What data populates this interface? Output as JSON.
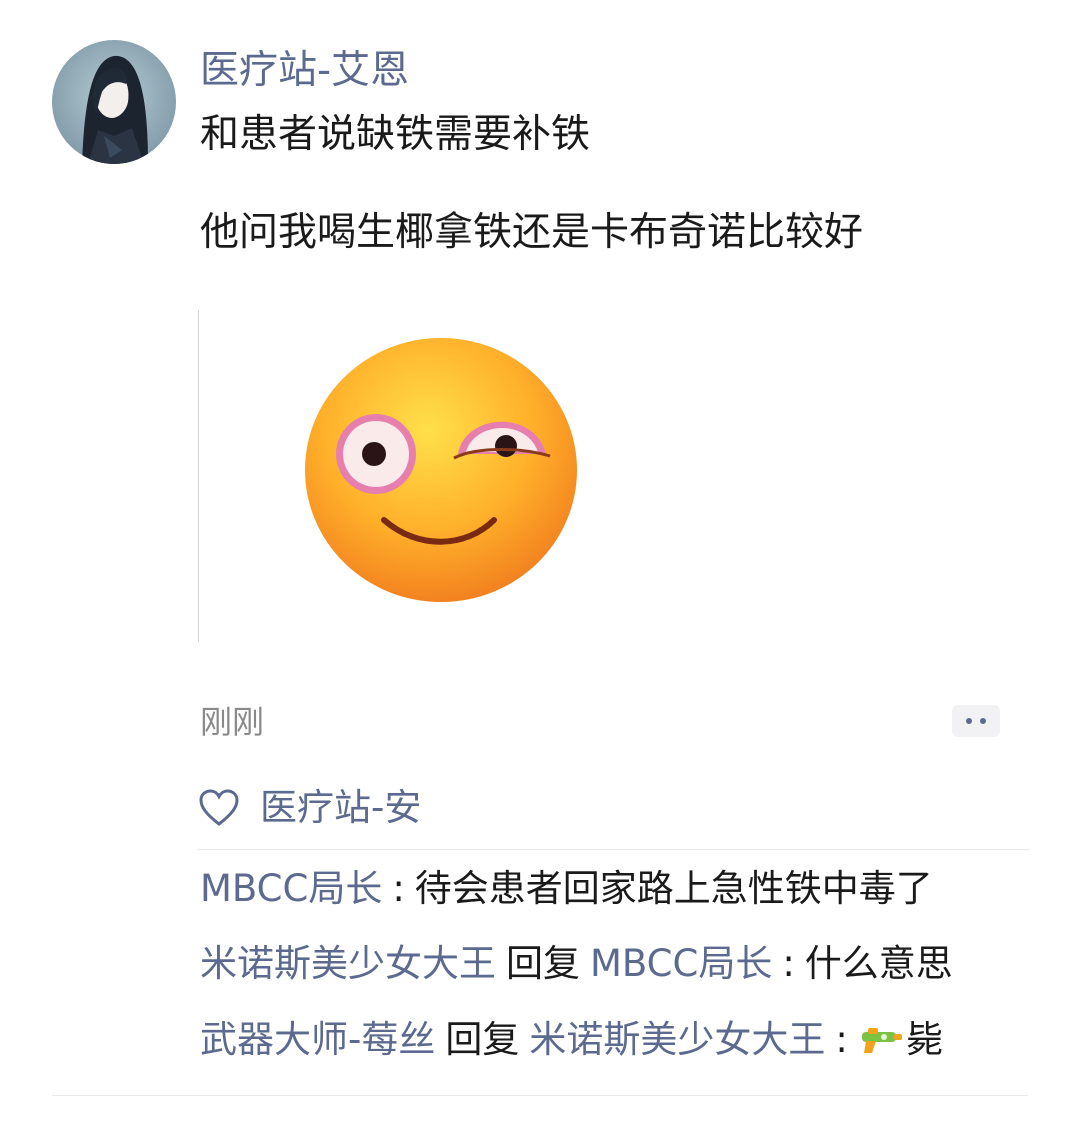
{
  "post": {
    "author": "医疗站-艾恩",
    "text_line_1": "和患者说缺铁需要补铁",
    "text_line_2": "他问我喝生椰拿铁还是卡布奇诺比较好",
    "image_icon": "smirking-face-emoji",
    "timestamp": "刚刚",
    "more_icon": "two-dots-icon"
  },
  "likes": {
    "icon": "heart-outline-icon",
    "names": "医疗站-安"
  },
  "comments": [
    {
      "user": "MBCC局长",
      "separator": ":",
      "text": "待会患者回家路上急性铁中毒了"
    },
    {
      "user": "米诺斯美少女大王",
      "reply_word": "回复",
      "reply_to": "MBCC局长",
      "separator": ":",
      "text": "什么意思"
    },
    {
      "user": "武器大师-莓丝",
      "reply_word": "回复",
      "reply_to": "米诺斯美少女大王",
      "separator": ":",
      "emoji": "water-pistol-icon",
      "text": "毙"
    }
  ],
  "colors": {
    "link": "#5b6a8e",
    "text": "#1a1a1a",
    "muted": "#8a8a8a",
    "divider": "#eaeaea"
  }
}
